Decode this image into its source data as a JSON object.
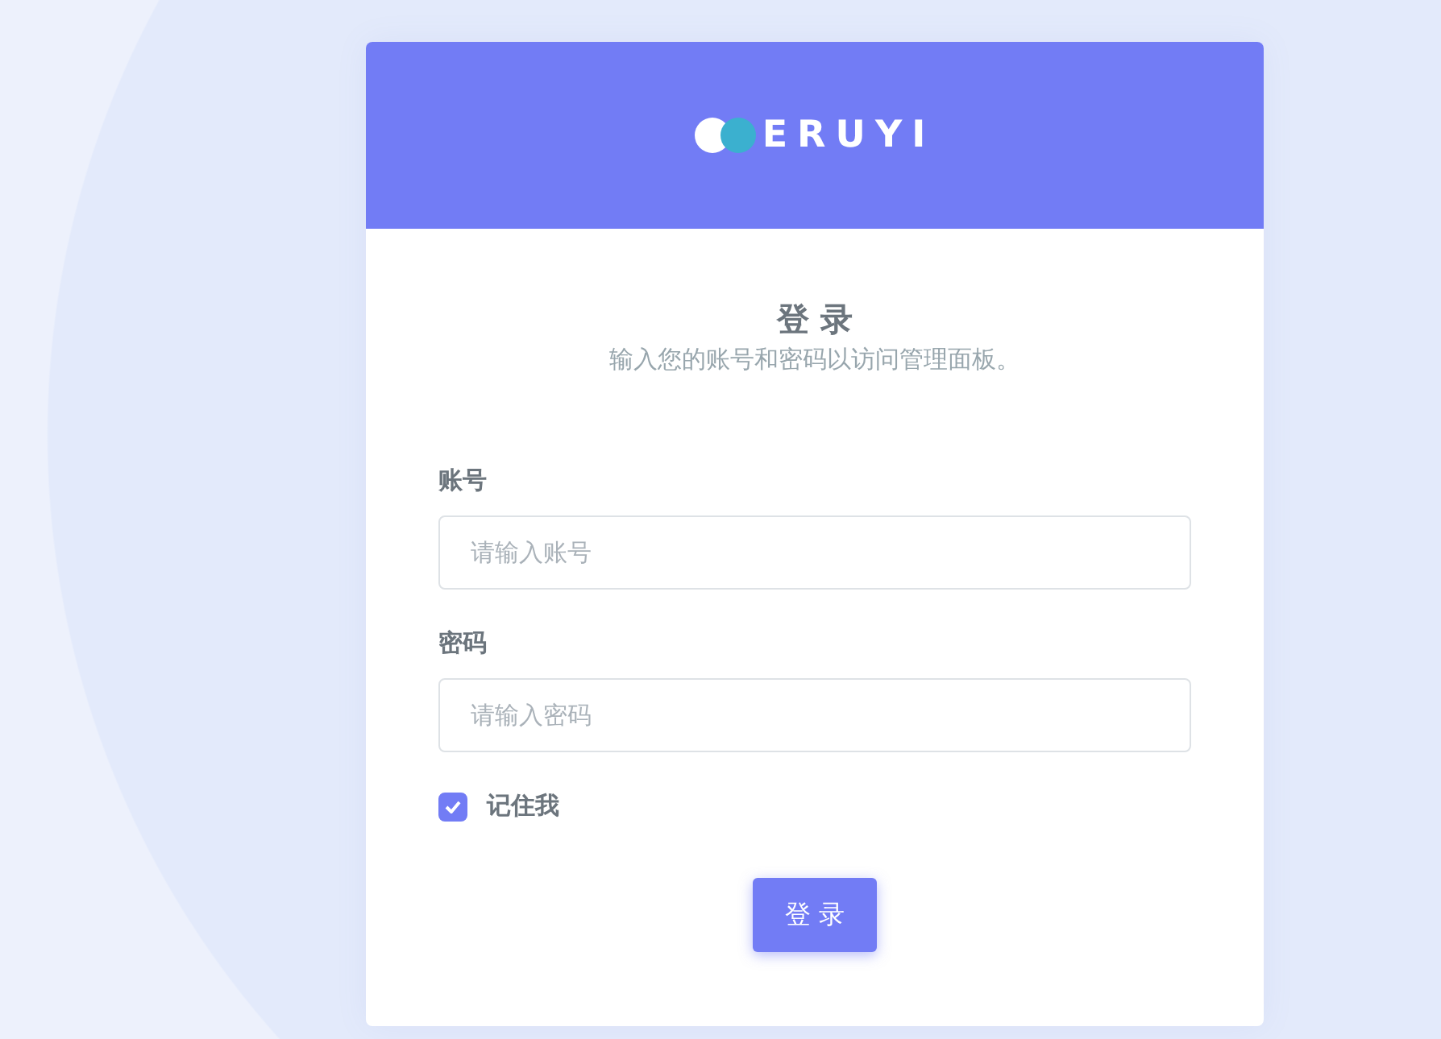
{
  "logo": {
    "text": "ERUYI"
  },
  "title": "登 录",
  "subtitle": "输入您的账号和密码以访问管理面板。",
  "fields": [
    {
      "label": "账号",
      "placeholder": "请输入账号"
    },
    {
      "label": "密码",
      "placeholder": "请输入密码"
    }
  ],
  "remember": {
    "label": "记住我",
    "checked": true
  },
  "submit": "登 录"
}
